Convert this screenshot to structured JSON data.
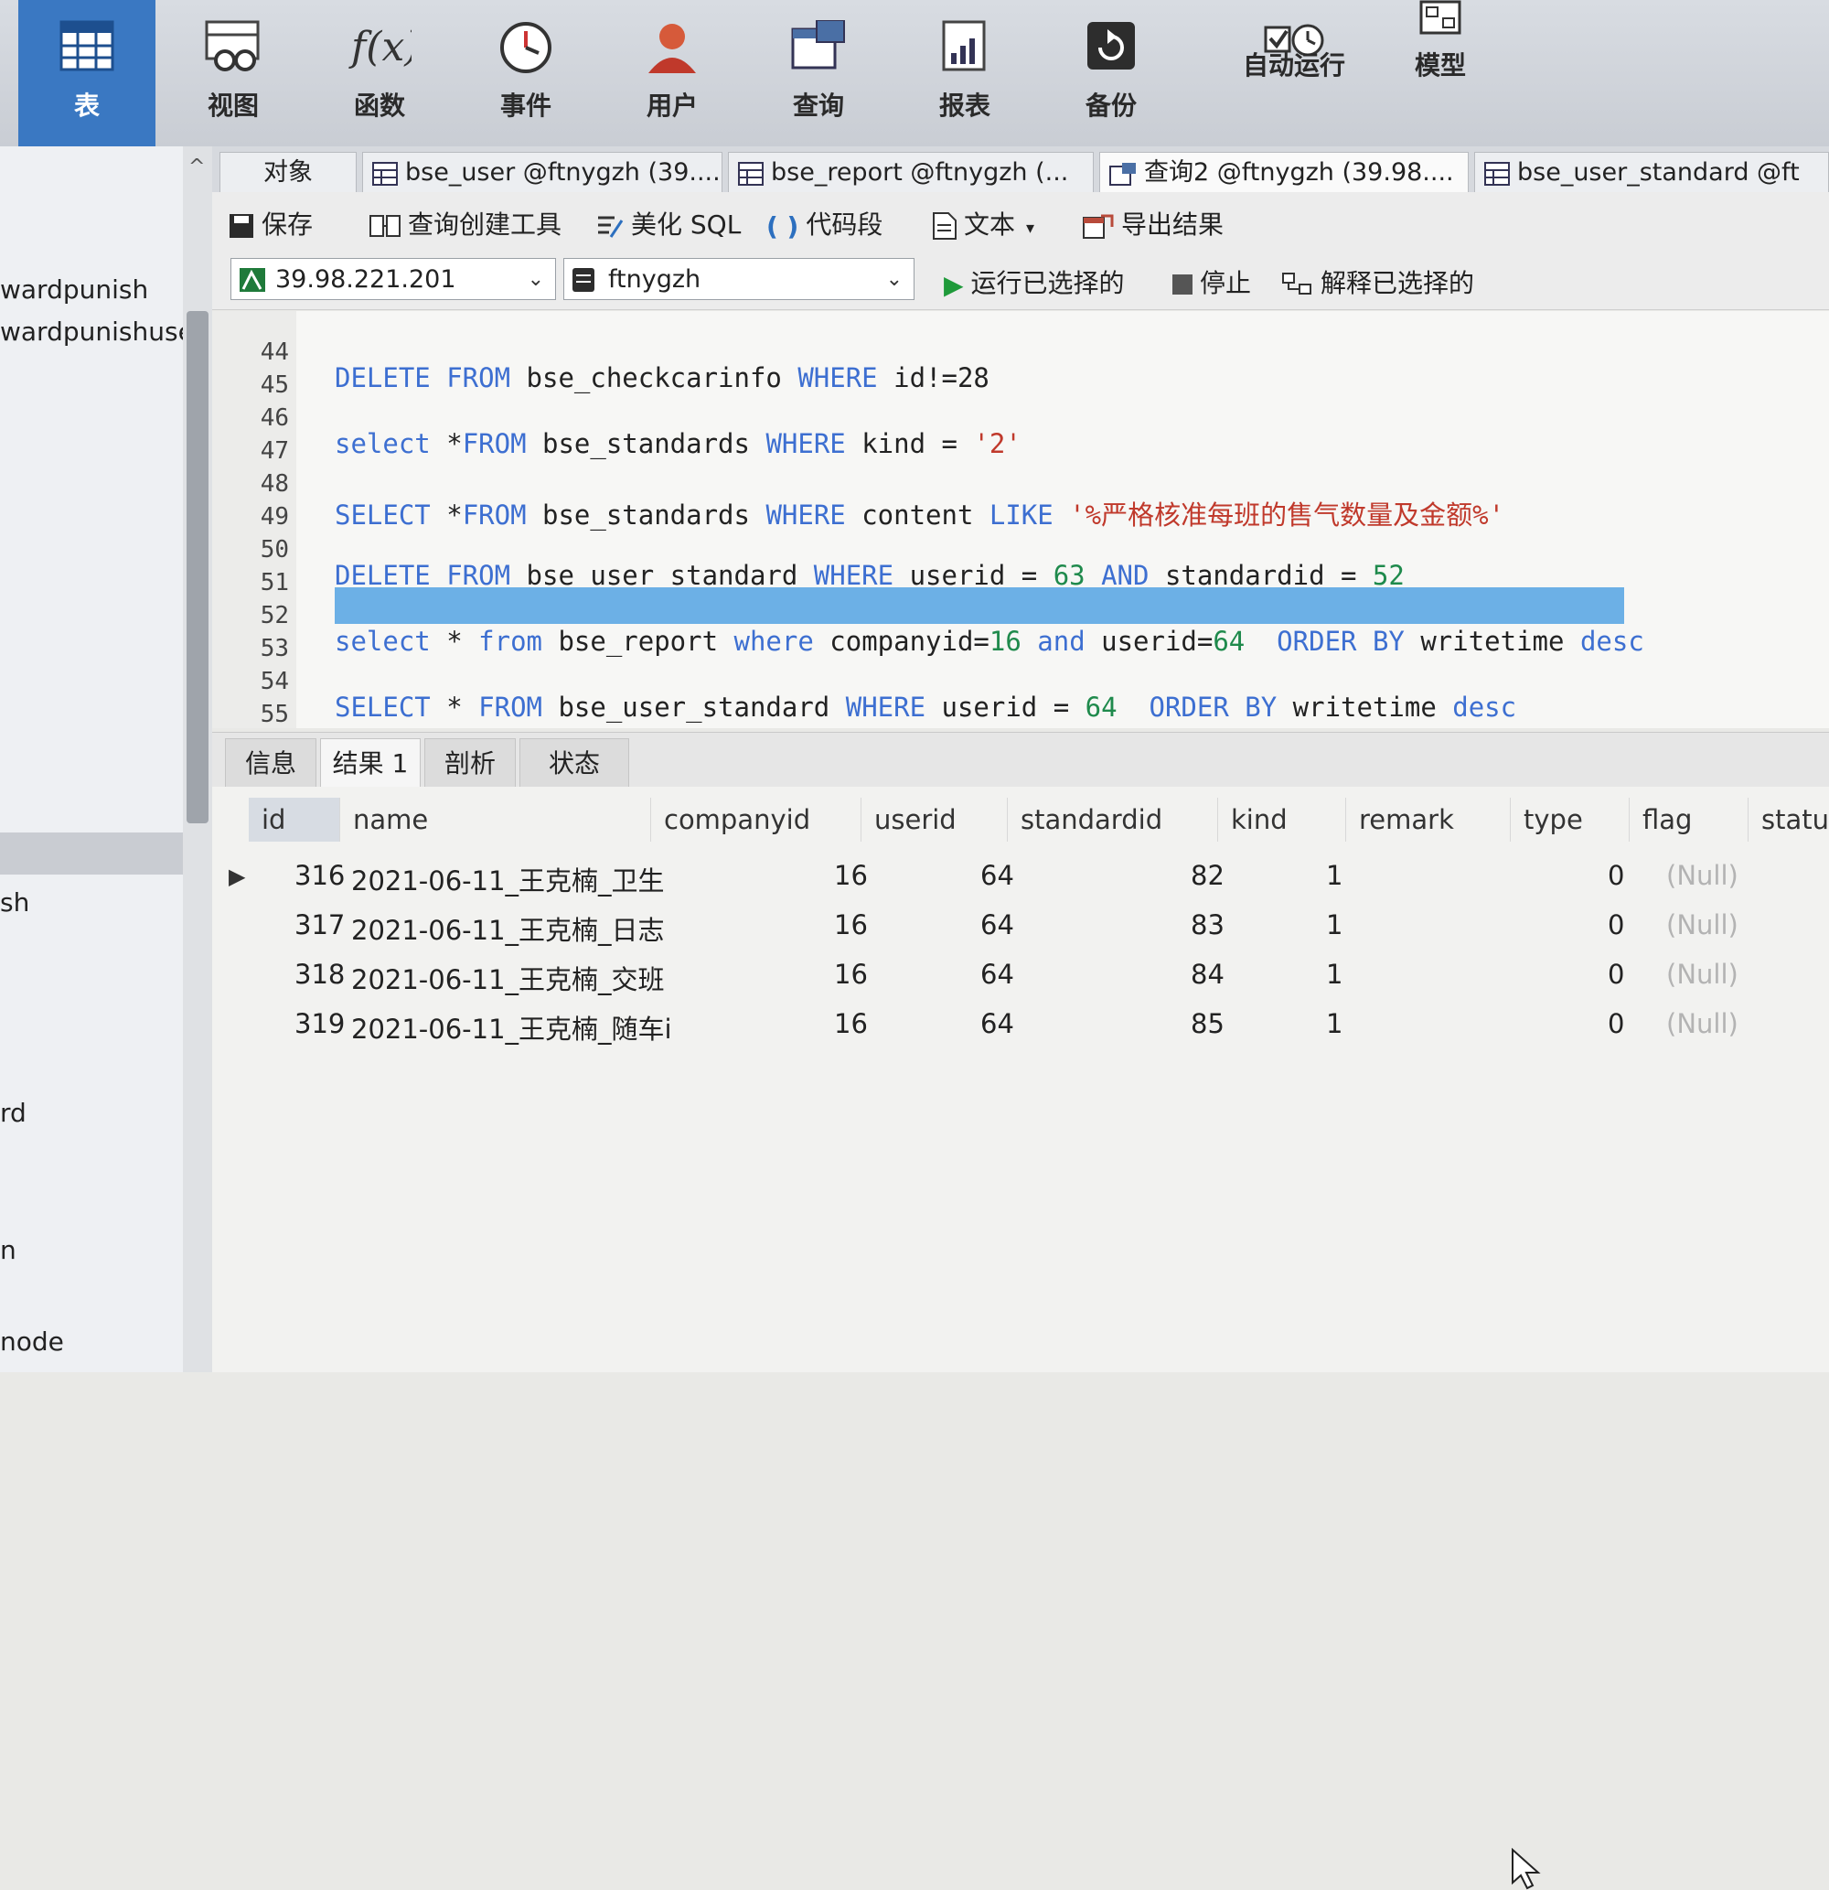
{
  "ribbon": {
    "items": [
      {
        "label": "表",
        "icon": "table-icon",
        "active": true
      },
      {
        "label": "视图",
        "icon": "view-icon"
      },
      {
        "label": "函数",
        "icon": "function-icon"
      },
      {
        "label": "事件",
        "icon": "clock-icon"
      },
      {
        "label": "用户",
        "icon": "user-icon"
      },
      {
        "label": "查询",
        "icon": "query-icon"
      },
      {
        "label": "报表",
        "icon": "report-icon"
      },
      {
        "label": "备份",
        "icon": "backup-icon"
      },
      {
        "label": "自动运行",
        "icon": "auto-run-icon"
      },
      {
        "label": "模型",
        "icon": "model-icon"
      }
    ]
  },
  "sidebar": {
    "items": [
      "wardpunish",
      "wardpunishuser",
      "sh",
      "rd",
      "n",
      "node"
    ]
  },
  "tabs": [
    {
      "label": "对象"
    },
    {
      "label": "bse_user @ftnygzh (39...."
    },
    {
      "label": "bse_report @ftnygzh (..."
    },
    {
      "label": "查询2 @ftnygzh (39.98...."
    },
    {
      "label": "bse_user_standard @ft"
    }
  ],
  "toolbar": {
    "save": "保存",
    "query_builder": "查询创建工具",
    "beautify": "美化 SQL",
    "snippet": "代码段",
    "text": "文本",
    "export": "导出结果",
    "run_selected": "运行已选择的",
    "stop": "停止",
    "explain_selected": "解释已选择的"
  },
  "connection": {
    "server": "39.98.221.201",
    "database": "ftnygzh"
  },
  "editor": {
    "line_numbers": [
      "44",
      "45",
      "46",
      "47",
      "48",
      "49",
      "50",
      "51",
      "52",
      "53",
      "54",
      "55"
    ],
    "lines": {
      "l45": {
        "kw1": "DELETE FROM",
        "t1": " bse_checkcarinfo ",
        "kw2": "WHERE",
        "t2": " id!=28"
      },
      "l47": {
        "kw1": "select",
        "t1": " *",
        "kw2": "FROM",
        "t2": " bse_standards ",
        "kw3": "WHERE",
        "t3": " kind = ",
        "s1": "'2'"
      },
      "l49": {
        "kw1": "SELECT",
        "t1": " *",
        "kw2": "FROM",
        "t2": " bse_standards ",
        "kw3": "WHERE",
        "t3": " content ",
        "kw4": "LIKE",
        "s1": " '%严格核准每班的售气数量及金额%'"
      },
      "l51": {
        "kw1": "DELETE FROM",
        "t1": " bse_user_standard ",
        "kw2": "WHERE",
        "t2": " userid = ",
        "n1": "63",
        "kw3": " AND",
        "t3": " standardid = ",
        "n2": "52"
      },
      "l53": {
        "kw1": "select",
        "t1": " * ",
        "kw2": "from",
        "t2": " bse_report ",
        "kw3": "where",
        "t3": " companyid=",
        "n1": "16",
        "kw4": " and",
        "t4": " userid=",
        "n2": "64",
        "kw5": "  ORDER BY",
        "t5": " writetime ",
        "kw6": "desc"
      },
      "l55": {
        "kw1": "SELECT",
        "t1": " * ",
        "kw2": "FROM",
        "t2": " bse_user_standard ",
        "kw3": "WHERE",
        "t3": " userid = ",
        "n1": "64",
        "kw4": "  ORDER BY",
        "t4": " writetime ",
        "kw5": "desc"
      }
    }
  },
  "result_tabs": [
    "信息",
    "结果 1",
    "剖析",
    "状态"
  ],
  "grid": {
    "columns": [
      "id",
      "name",
      "companyid",
      "userid",
      "standardid",
      "kind",
      "remark",
      "type",
      "flag",
      "statu"
    ],
    "rows": [
      {
        "id": "316",
        "name": "2021-06-11_王克楠_卫生",
        "companyid": "16",
        "userid": "64",
        "standardid": "82",
        "kind": "1",
        "type": "0",
        "flag": "(Null)"
      },
      {
        "id": "317",
        "name": "2021-06-11_王克楠_日志",
        "companyid": "16",
        "userid": "64",
        "standardid": "83",
        "kind": "1",
        "type": "0",
        "flag": "(Null)"
      },
      {
        "id": "318",
        "name": "2021-06-11_王克楠_交班",
        "companyid": "16",
        "userid": "64",
        "standardid": "84",
        "kind": "1",
        "type": "0",
        "flag": "(Null)"
      },
      {
        "id": "319",
        "name": "2021-06-11_王克楠_随车i",
        "companyid": "16",
        "userid": "64",
        "standardid": "85",
        "kind": "1",
        "type": "0",
        "flag": "(Null)"
      }
    ]
  },
  "colors": {
    "keyword": "#3d6fd1",
    "string": "#c0392b",
    "number": "#1f8a4c",
    "highlight": "#6cb0e6",
    "active_ribbon": "#3a78c2"
  }
}
